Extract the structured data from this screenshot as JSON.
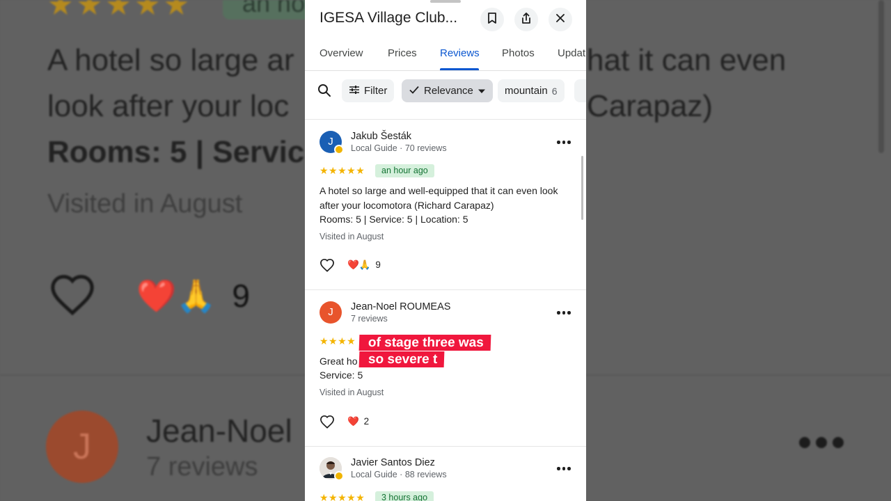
{
  "background": {
    "stars": "★★★★★",
    "time_fragment": "an ho",
    "line1": "A hotel so large ar",
    "line1_right": "hat it can even",
    "line2": "look after your loc",
    "line2_right": "Carapaz)",
    "line3": "Rooms: 5 | Servic",
    "visited": "Visited in August",
    "reactions": "❤️🙏",
    "reaction_count": "9",
    "avatar_letter": "J",
    "name": "Jean-Noel",
    "sub": "7 reviews"
  },
  "header": {
    "title": "IGESA Village Club..."
  },
  "tabs": [
    {
      "label": "Overview"
    },
    {
      "label": "Prices"
    },
    {
      "label": "Reviews"
    },
    {
      "label": "Photos"
    },
    {
      "label": "Updat"
    }
  ],
  "chips": {
    "filter": "Filter",
    "sort": "Relevance",
    "topic": "mountain",
    "topic_count": "6"
  },
  "reviews": [
    {
      "avatar_letter": "J",
      "avatar_color": "#1a5fb4",
      "name": "Jakub Šesták",
      "sub": "Local Guide · 70 reviews",
      "stars": "★★★★★",
      "time": "an hour ago",
      "text": "A hotel so large and well-equipped that it can even look after your locomotora (Richard Carapaz)",
      "ratings": "Rooms: 5 | Service: 5 | Location: 5",
      "visited": "Visited in August",
      "reactions": "❤️🙏",
      "reaction_count": "9"
    },
    {
      "avatar_letter": "J",
      "avatar_color": "#e8542c",
      "name": "Jean-Noel ROUMEAS",
      "sub": "7 reviews",
      "stars": "★★★★",
      "text_partial": "Great ho",
      "ratings": "Service: 5",
      "visited": "Visited in August",
      "reactions": "❤️",
      "reaction_count": "2"
    },
    {
      "name": "Javier Santos Diez",
      "sub": "Local Guide · 88 reviews",
      "stars": "★★★★★",
      "time": "3 hours ago"
    }
  ],
  "caption": {
    "line1": "of stage three was",
    "line2": "so severe t"
  }
}
